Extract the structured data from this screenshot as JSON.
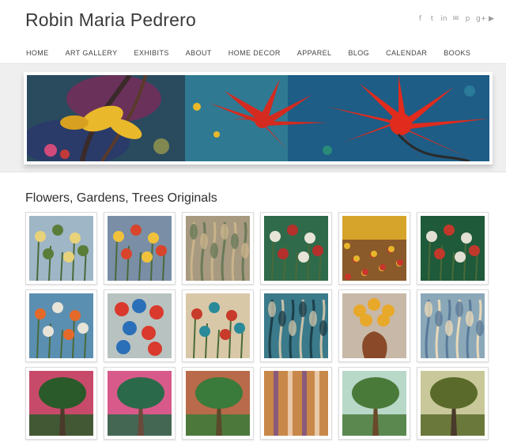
{
  "site": {
    "title": "Robin Maria Pedrero"
  },
  "social": [
    {
      "icon": "facebook-icon",
      "glyph": "f"
    },
    {
      "icon": "twitter-icon",
      "glyph": "t"
    },
    {
      "icon": "linkedin-icon",
      "glyph": "in"
    },
    {
      "icon": "email-icon",
      "glyph": "✉"
    },
    {
      "icon": "pinterest-icon",
      "glyph": "p"
    },
    {
      "icon": "google-plus-icon",
      "glyph": "g+"
    },
    {
      "icon": "youtube-icon",
      "glyph": "▶"
    }
  ],
  "nav": {
    "items": [
      {
        "label": "HOME"
      },
      {
        "label": "ART GALLERY"
      },
      {
        "label": "EXHIBITS"
      },
      {
        "label": "ABOUT"
      },
      {
        "label": "HOME DECOR"
      },
      {
        "label": "APPAREL"
      },
      {
        "label": "BLOG"
      },
      {
        "label": "CALENDAR"
      },
      {
        "label": "BOOKS"
      }
    ]
  },
  "section": {
    "title": "Flowers, Gardens, Trees Originals"
  },
  "colors": {
    "banner_red": "#d42a1f",
    "banner_teal": "#2a6e8a",
    "banner_yellow": "#e9b82b"
  },
  "thumbnails": [
    {
      "name": "thumb-pale-wildflowers",
      "bg": "#9fb6c6",
      "accent": "#e8d27a",
      "accent2": "#5b7d3a",
      "style": "flowers"
    },
    {
      "name": "thumb-bright-bouquet",
      "bg": "#7a8ea6",
      "accent": "#f0c23b",
      "accent2": "#d8452c",
      "style": "flowers"
    },
    {
      "name": "thumb-earthy-leaves",
      "bg": "#a79a80",
      "accent": "#6a7a5a",
      "accent2": "#c9b38a",
      "style": "leaves"
    },
    {
      "name": "thumb-garden-white-blooms",
      "bg": "#2f6b4a",
      "accent": "#e8e4d8",
      "accent2": "#b3302c",
      "style": "flowers"
    },
    {
      "name": "thumb-golden-field",
      "bg": "#8a5a2a",
      "accent": "#e8b62a",
      "accent2": "#c8352b",
      "style": "field"
    },
    {
      "name": "thumb-dark-garden",
      "bg": "#1f5a3a",
      "accent": "#e2e0d4",
      "accent2": "#c0392b",
      "style": "flowers"
    },
    {
      "name": "thumb-orange-poppies",
      "bg": "#5b8fb2",
      "accent": "#e46a2a",
      "accent2": "#e8e4d8",
      "style": "flowers"
    },
    {
      "name": "thumb-colorful-circles",
      "bg": "#b8c2c0",
      "accent": "#d93a2d",
      "accent2": "#2a6fb8",
      "style": "circles"
    },
    {
      "name": "thumb-bird-garden",
      "bg": "#d8c8a8",
      "accent": "#c83a2a",
      "accent2": "#2a8a9a",
      "style": "flowers"
    },
    {
      "name": "thumb-teal-trees",
      "bg": "#3a7a8a",
      "accent": "#c8c0a8",
      "accent2": "#1d3f4a",
      "style": "leaves"
    },
    {
      "name": "thumb-vase-sunflowers",
      "bg": "#c8b8a8",
      "accent": "#e8a82a",
      "accent2": "#8a4a2a",
      "style": "vase"
    },
    {
      "name": "thumb-blue-stems",
      "bg": "#8aa8b8",
      "accent": "#e8d8b8",
      "accent2": "#5a7a9a",
      "style": "leaves"
    },
    {
      "name": "thumb-pink-sky-tree",
      "bg": "#c84a6a",
      "accent": "#2a5a2a",
      "accent2": "#4a3a2a",
      "style": "tree"
    },
    {
      "name": "thumb-magenta-tree",
      "bg": "#d85a8a",
      "accent": "#2a6a4a",
      "accent2": "#6a4a3a",
      "style": "tree"
    },
    {
      "name": "thumb-swing-tree",
      "bg": "#b86a4a",
      "accent": "#3a7a3a",
      "accent2": "#5a4a2a",
      "style": "tree"
    },
    {
      "name": "thumb-autumn-birches",
      "bg": "#c8884a",
      "accent": "#e8c8a8",
      "accent2": "#8a5a7a",
      "style": "birch"
    },
    {
      "name": "thumb-green-tree",
      "bg": "#b8d8c8",
      "accent": "#4a7a3a",
      "accent2": "#6a4a2a",
      "style": "tree"
    },
    {
      "name": "thumb-olive-tree",
      "bg": "#c8c89a",
      "accent": "#5a6a2a",
      "accent2": "#4a3a2a",
      "style": "tree"
    }
  ]
}
